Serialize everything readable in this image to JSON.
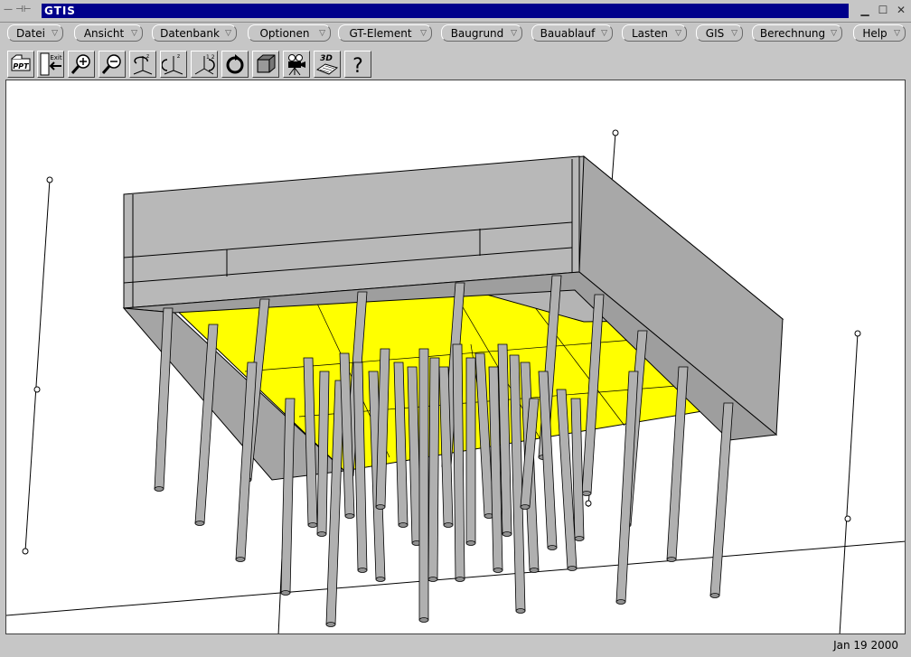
{
  "window": {
    "title": "GTIS",
    "sysmenu_glyph": "— ⊣⊢"
  },
  "menu": [
    {
      "label": "Datei"
    },
    {
      "label": "Ansicht"
    },
    {
      "label": "Datenbank"
    },
    {
      "label": "Optionen"
    },
    {
      "label": "GT-Element"
    },
    {
      "label": "Baugrund"
    },
    {
      "label": "Bauablauf"
    },
    {
      "label": "Lasten"
    },
    {
      "label": "GIS"
    },
    {
      "label": "Berechnung"
    },
    {
      "label": "Help"
    }
  ],
  "toolbar": {
    "tools": [
      {
        "name": "ppt-icon",
        "text": "PPT"
      },
      {
        "name": "exit-icon",
        "text": "Exit"
      },
      {
        "name": "zoom-in-icon",
        "text": ""
      },
      {
        "name": "zoom-out-icon",
        "text": ""
      },
      {
        "name": "rotate-xy-icon",
        "text": ""
      },
      {
        "name": "rotate-z-icon",
        "text": ""
      },
      {
        "name": "rotate-axes-icon",
        "text": ""
      },
      {
        "name": "reset-view-icon",
        "text": ""
      },
      {
        "name": "shade-box-icon",
        "text": ""
      },
      {
        "name": "camera-icon",
        "text": ""
      },
      {
        "name": "3d-view-icon",
        "text": "3D"
      },
      {
        "name": "help-icon",
        "text": "?"
      }
    ]
  },
  "status": {
    "date": "Jan 19 2000"
  },
  "colors": {
    "title_bg": "#00008b",
    "slab": "#b4b4b4",
    "yellow": "#ffff00"
  }
}
